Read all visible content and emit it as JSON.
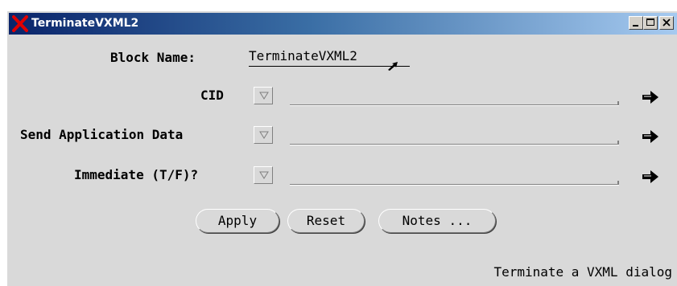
{
  "window": {
    "title": "TerminateVXML2"
  },
  "form": {
    "block_name_label": "Block Name:",
    "block_name_value": "TerminateVXML2",
    "fields": [
      {
        "label": "CID",
        "value": ""
      },
      {
        "label": "Send Application Data",
        "value": ""
      },
      {
        "label": "Immediate (T/F)?",
        "value": ""
      }
    ]
  },
  "buttons": {
    "apply": "Apply",
    "reset": "Reset",
    "notes": "Notes ..."
  },
  "status": {
    "text": "Terminate a VXML dialog"
  },
  "icons": {
    "app": "red-x-icon",
    "minimize": "minimize-icon",
    "maximize": "maximize-icon",
    "close": "close-icon",
    "dropdown": "triangle-down-icon",
    "field_action": "arrow-right-icon"
  },
  "colors": {
    "titlebar_start": "#0a246a",
    "titlebar_end": "#a6caf0",
    "dialog_bg": "#d9d9d9",
    "app_icon": "#e00000"
  }
}
